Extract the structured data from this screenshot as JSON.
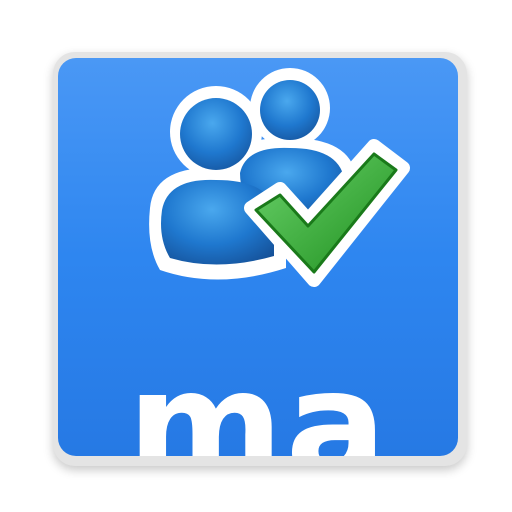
{
  "icon": {
    "name": "users-check-app-icon",
    "label": "ma",
    "colors": {
      "tile": "#2e86f0",
      "tile_light": "#4a98f5",
      "plate": "#e4e4e4",
      "users": "#1a6bc2",
      "users_light": "#4aa8ee",
      "outline": "#ffffff",
      "check": "#2aa52a",
      "check_light": "#6cd36c",
      "text": "#ffffff"
    }
  }
}
